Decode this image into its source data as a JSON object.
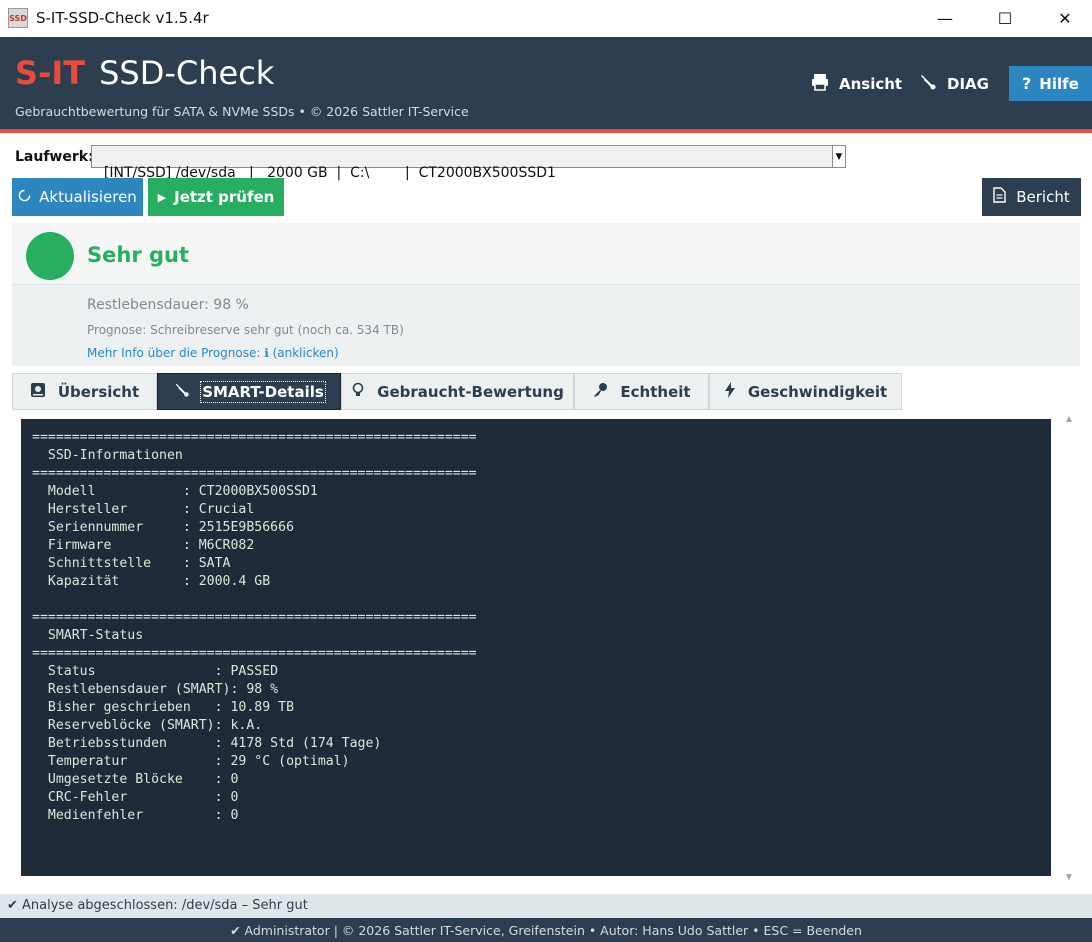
{
  "window": {
    "title": "S-IT-SSD-Check  v1.5.4r",
    "icon_text": "SSD",
    "minimize": "—",
    "maximize": "☐",
    "close": "✕"
  },
  "header": {
    "brand_prefix": "S-IT",
    "brand_name": "SSD-Check",
    "subtitle": "Gebrauchtbewertung für SATA & NVMe SSDs  •  © 2026 Sattler IT-Service",
    "buttons": {
      "view": "Ansicht",
      "diag": "DIAG",
      "help": "Hilfe"
    }
  },
  "drive": {
    "label": "Laufwerk:",
    "selected": "[INT/SSD] /dev/sda   |   2000 GB  |  C:\\        |  CT2000BX500SSD1"
  },
  "actions": {
    "refresh": "Aktualisieren",
    "check": "Jetzt prüfen",
    "report": "Bericht"
  },
  "status": {
    "rating": "Sehr gut",
    "life": "Restlebensdauer: 98 %",
    "prognose": "Prognose: Schreibreserve sehr gut  (noch ca. 534 TB)",
    "more_info": "Mehr Info über die Prognose:  ℹ  (anklicken)",
    "color": "#27ae60"
  },
  "tabs": [
    {
      "label": "Übersicht",
      "icon": "drive-icon"
    },
    {
      "label": "SMART-Details",
      "icon": "wrench-icon",
      "active": true
    },
    {
      "label": "Gebraucht-Bewertung",
      "icon": "lightbulb-icon"
    },
    {
      "label": "Echtheit",
      "icon": "key-icon"
    },
    {
      "label": "Geschwindigkeit",
      "icon": "lightning-icon"
    }
  ],
  "console": {
    "text": "========================================================\n  SSD-Informationen\n========================================================\n  Modell           : CT2000BX500SSD1\n  Hersteller       : Crucial\n  Seriennummer     : 2515E9B56666\n  Firmware         : M6CR082\n  Schnittstelle    : SATA\n  Kapazität        : 2000.4 GB\n\n========================================================\n  SMART-Status\n========================================================\n  Status               : PASSED\n  Restlebensdauer (SMART): 98 %\n  Bisher geschrieben   : 10.89 TB\n  Reserveblöcke (SMART): k.A.\n  Betriebsstunden      : 4178 Std (174 Tage)\n  Temperatur           : 29 °C (optimal)\n  Umgesetzte Blöcke    : 0\n  CRC-Fehler           : 0\n  Medienfehler         : 0"
  },
  "statusbar": {
    "text": "✔  Analyse abgeschlossen: /dev/sda  –  Sehr gut"
  },
  "footer": {
    "text": "✔ Administrator  |  © 2026 Sattler IT-Service, Greifenstein  •  Autor: Hans Udo Sattler  •  ESC = Beenden"
  },
  "colors": {
    "header_bg": "#2c3e50",
    "accent_red": "#e74c3c",
    "accent_blue": "#2e86c1",
    "accent_green": "#27ae60",
    "console_bg": "#1f2b38"
  }
}
